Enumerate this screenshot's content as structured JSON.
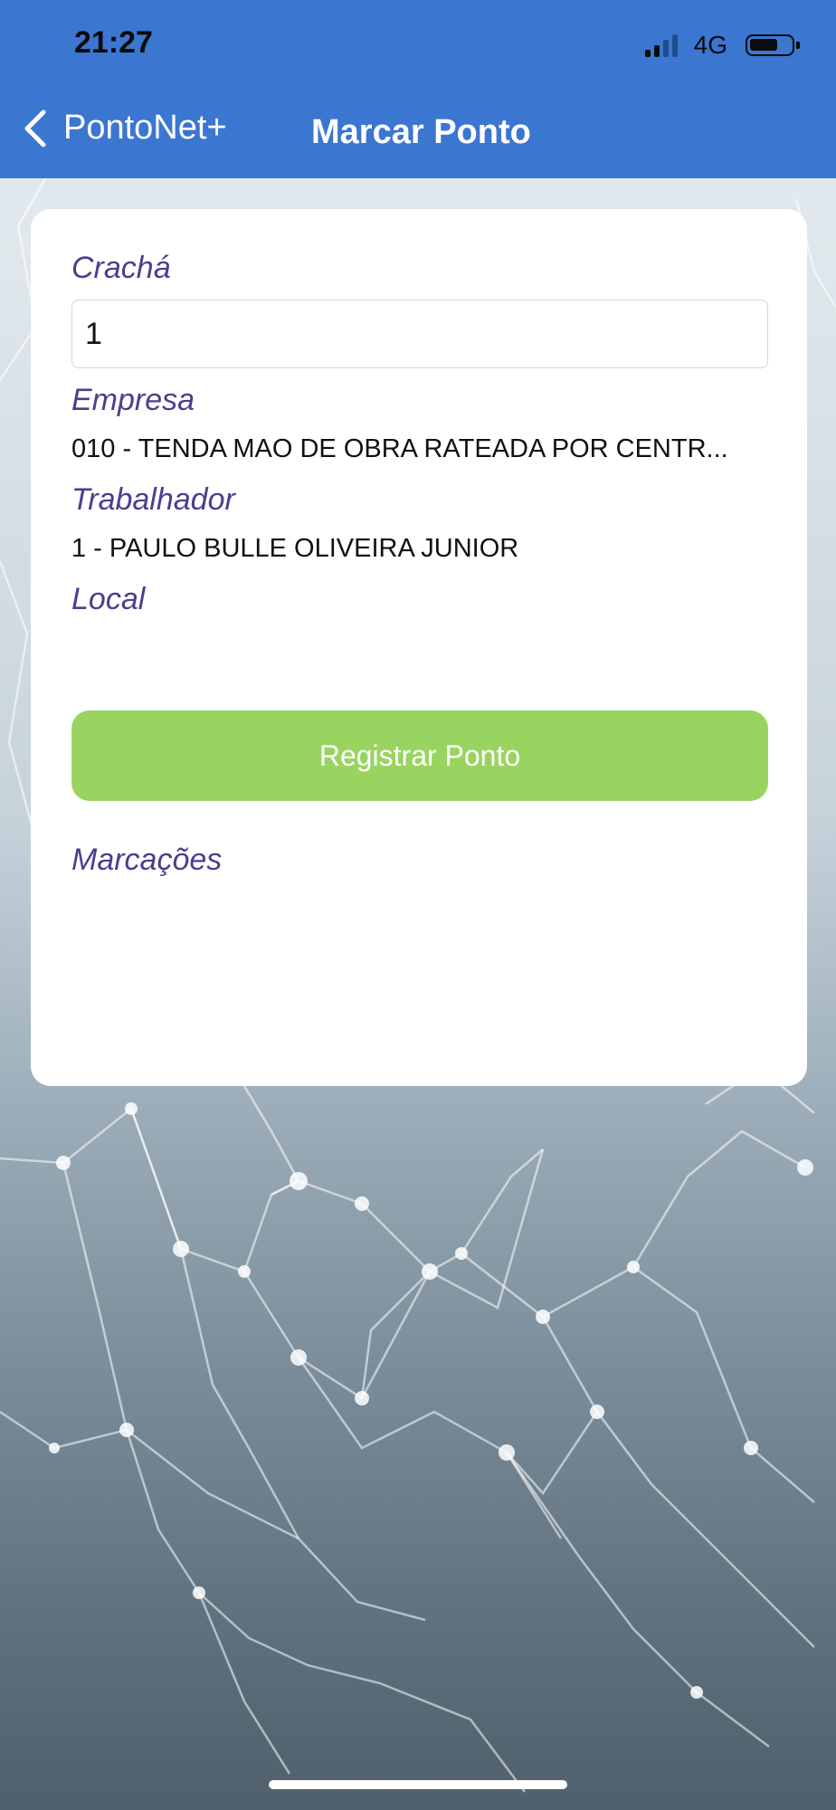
{
  "status_bar": {
    "time": "21:27",
    "network": "4G",
    "signal_icon": "signal-bars-icon",
    "battery_icon": "battery-icon"
  },
  "nav": {
    "back_label": "PontoNet+",
    "back_icon": "chevron-left-icon",
    "title": "Marcar Ponto"
  },
  "form": {
    "cracha_label": "Crachá",
    "cracha_value": "1",
    "empresa_label": "Empresa",
    "empresa_value": "010 - TENDA MAO DE OBRA RATEADA POR CENTR...",
    "trabalhador_label": "Trabalhador",
    "trabalhador_value": "1 - PAULO BULLE OLIVEIRA JUNIOR",
    "local_label": "Local",
    "local_value": "",
    "register_button_label": "Registrar Ponto",
    "marcacoes_label": "Marcações"
  },
  "colors": {
    "header_bg": "#3b76d1",
    "label_text": "#4a3f8f",
    "button_bg": "#99d461"
  }
}
